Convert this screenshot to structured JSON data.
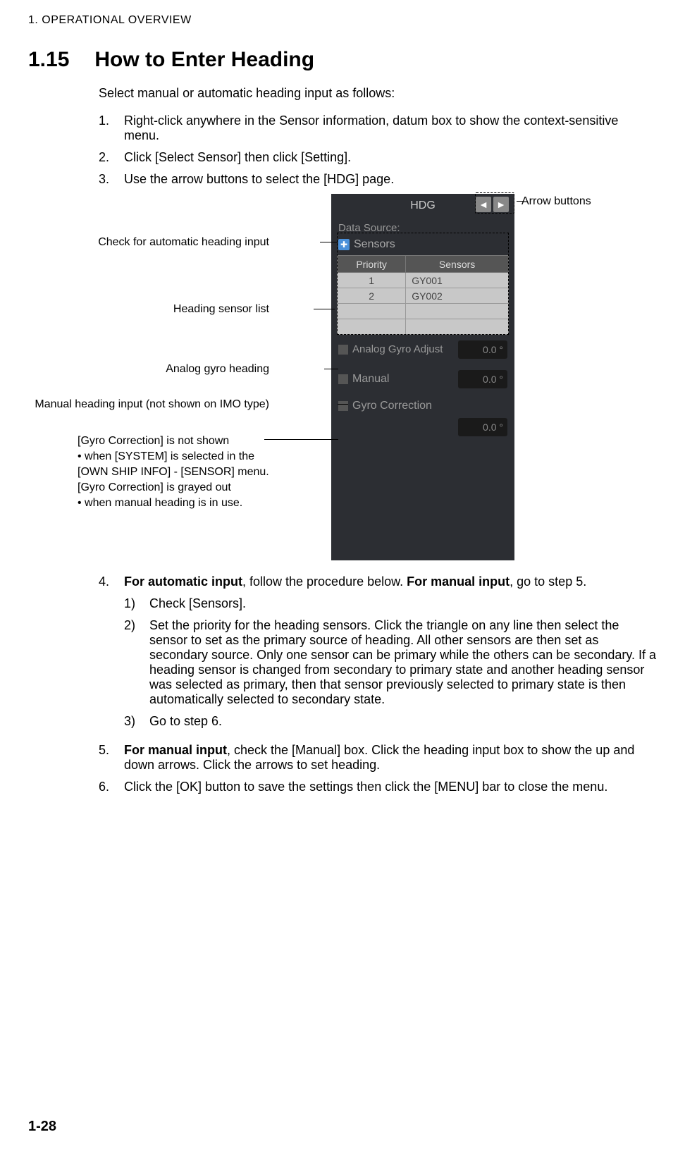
{
  "chapter": "1.  OPERATIONAL OVERVIEW",
  "section_num": "1.15",
  "section_title": "How to Enter Heading",
  "intro": "Select manual or automatic heading input as follows:",
  "steps": {
    "s1": "Right-click anywhere in the Sensor information, datum box to show the context-sensitive menu.",
    "s2": "Click [Select Sensor] then click [Setting].",
    "s3": "Use the arrow buttons to select the [HDG] page.",
    "s4a": "For automatic input",
    "s4b": ", follow the procedure below. ",
    "s4c": "For manual input",
    "s4d": ", go to step 5.",
    "s4_1": "Check [Sensors].",
    "s4_2": "Set the priority for the heading sensors. Click the triangle on any line then select the sensor to set as the primary source of heading. All other sensors are then set as secondary source. Only one sensor can be primary while the others can be secondary. If a heading sensor is changed from secondary to primary state and another heading sensor was selected as primary, then that sensor previously selected to primary state is then automatically selected to secondary state.",
    "s4_3": "Go to step 6.",
    "s5a": "For manual input",
    "s5b": ", check the [Manual] box. Click the heading input box to show the up and down arrows. Click the arrows to set heading.",
    "s6": "Click the [OK] button to save the settings then click the [MENU] bar to close the menu."
  },
  "panel": {
    "title": "HDG",
    "data_source": "Data Source:",
    "sensors_label": "Sensors",
    "col_priority": "Priority",
    "col_sensors": "Sensors",
    "rows": [
      {
        "p": "1",
        "s": "GY001"
      },
      {
        "p": "2",
        "s": "GY002"
      }
    ],
    "analog_gyro": "Analog Gyro Adjust",
    "manual": "Manual",
    "gyro_correction": "Gyro Correction",
    "val": "0.0 °"
  },
  "callouts": {
    "arrow_buttons": "Arrow buttons",
    "check_auto": "Check for automatic heading input",
    "sensor_list": "Heading sensor list",
    "analog_gyro": "Analog gyro heading",
    "manual_input": "Manual heading input (not shown on IMO type)",
    "gyro_corr": "[Gyro Correction] is not shown\n• when [SYSTEM] is selected in the\n   [OWN SHIP INFO] - [SENSOR] menu.\n[Gyro Correction] is grayed out\n• when manual heading is in use."
  },
  "page_num": "1-28"
}
